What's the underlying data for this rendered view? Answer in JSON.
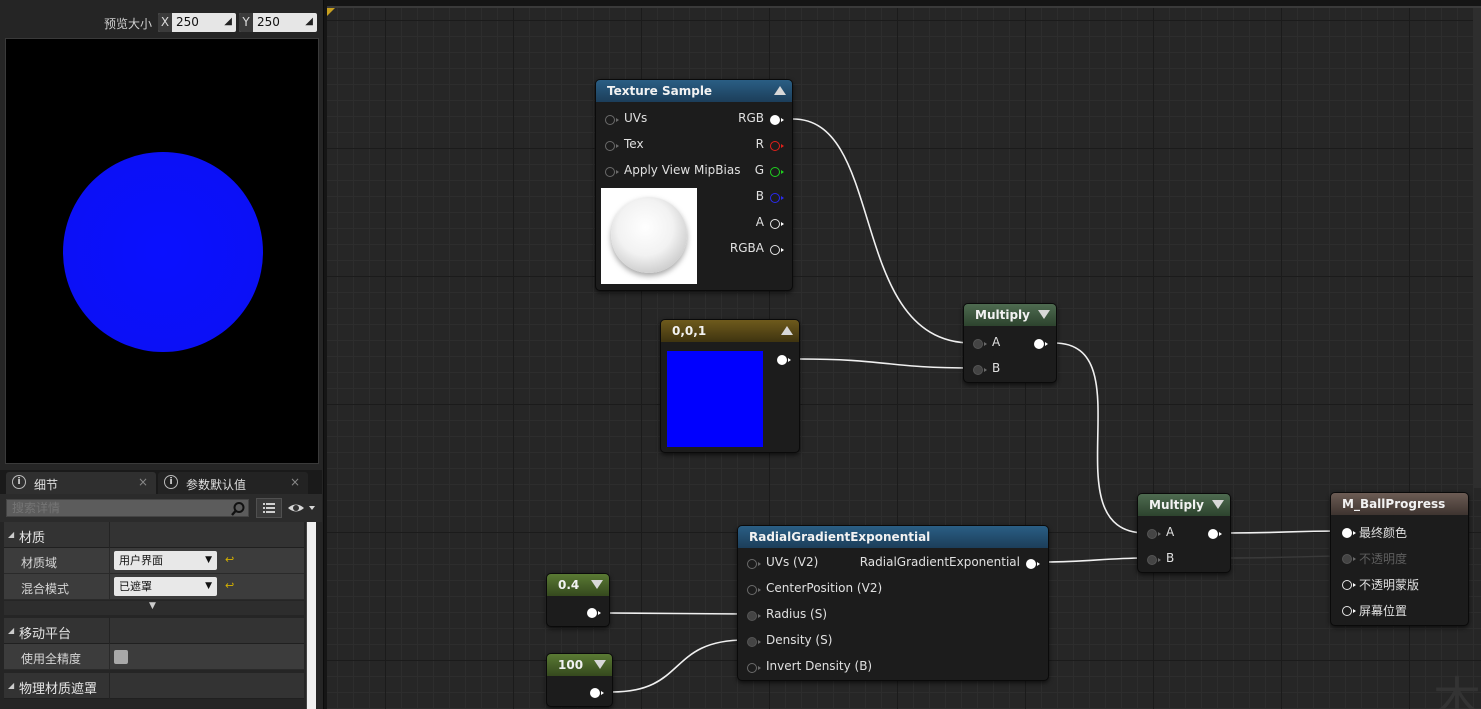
{
  "preview": {
    "label": "预览大小",
    "x_axis": "X",
    "x_value": "250",
    "y_axis": "Y",
    "y_value": "250"
  },
  "tabs": {
    "details": "细节",
    "params": "参数默认值",
    "close": "×"
  },
  "search": {
    "placeholder": "搜索详情"
  },
  "properties": {
    "cat_material": "材质",
    "material_domain_label": "材质域",
    "material_domain_value": "用户界面",
    "blend_mode_label": "混合模式",
    "blend_mode_value": "已遮罩",
    "cat_mobile": "移动平台",
    "full_precision_label": "使用全精度",
    "cat_phys_mask": "物理材质遮罩"
  },
  "nodes": {
    "texture_sample": {
      "title": "Texture Sample",
      "inputs": [
        "UVs",
        "Tex",
        "Apply View MipBias"
      ],
      "outputs": [
        "RGB",
        "R",
        "G",
        "B",
        "A",
        "RGBA"
      ]
    },
    "constant3": {
      "title": "0,0,1",
      "color": "#0000ff"
    },
    "multiply1": {
      "title": "Multiply",
      "inputs": [
        "A",
        "B"
      ]
    },
    "multiply2": {
      "title": "Multiply",
      "inputs": [
        "A",
        "B"
      ]
    },
    "radial": {
      "title": "RadialGradientExponential",
      "inputs": [
        "UVs (V2)",
        "CenterPosition (V2)",
        "Radius (S)",
        "Density (S)",
        "Invert Density (B)"
      ],
      "output": "RadialGradientExponential"
    },
    "const_radius": {
      "title": "0.4"
    },
    "const_density": {
      "title": "100"
    },
    "material": {
      "title": "M_BallProgress",
      "inputs": [
        "最终颜色",
        "不透明度",
        "不透明蒙版",
        "屏幕位置"
      ]
    }
  },
  "colors": {
    "preview_sphere": "#0a10ff",
    "reset_accent": "#d4b000"
  },
  "watermark": "木"
}
